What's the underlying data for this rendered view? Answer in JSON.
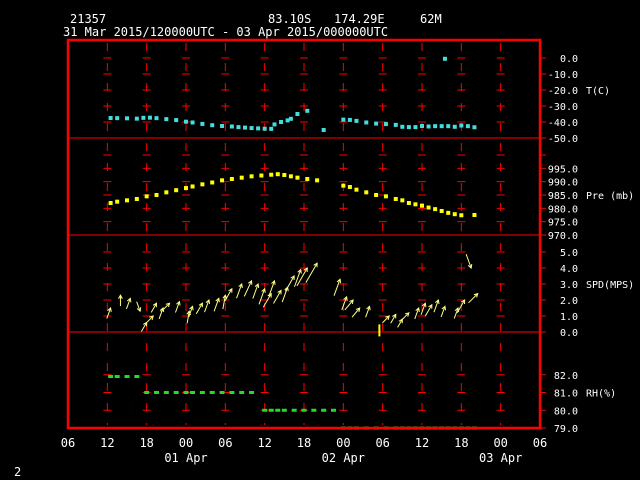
{
  "header": {
    "station": "21357",
    "lat": "83.10S",
    "lon": "174.29E",
    "elev": "62M",
    "period": "31 Mar 2015/120000UTC - 03 Apr 2015/000000UTC"
  },
  "page_number": "2",
  "colors": {
    "frame": "#ff0000",
    "grid": "#ff0000",
    "temp": "#44dddd",
    "pres": "#ffff00",
    "wind": "#ffff88",
    "rh": "#22dd22",
    "text": "#ffffff"
  },
  "chart_data": {
    "type": "scatter",
    "x_axis": {
      "unit": "hours since 31 Mar 2015 00UTC",
      "range": [
        6,
        78
      ],
      "ticks": [
        {
          "h": 6,
          "label": "06"
        },
        {
          "h": 12,
          "label": "12"
        },
        {
          "h": 18,
          "label": "18"
        },
        {
          "h": 24,
          "label": "00"
        },
        {
          "h": 30,
          "label": "06"
        },
        {
          "h": 36,
          "label": "12"
        },
        {
          "h": 42,
          "label": "18"
        },
        {
          "h": 48,
          "label": "00"
        },
        {
          "h": 54,
          "label": "06"
        },
        {
          "h": 60,
          "label": "12"
        },
        {
          "h": 66,
          "label": "18"
        },
        {
          "h": 72,
          "label": "00"
        },
        {
          "h": 78,
          "label": "06"
        }
      ],
      "day_labels": [
        {
          "h": 24,
          "label": "01 Apr"
        },
        {
          "h": 48,
          "label": "02 Apr"
        },
        {
          "h": 72,
          "label": "03 Apr"
        }
      ]
    },
    "panels": [
      {
        "key": "temp",
        "label": "T(C)",
        "range": [
          -50,
          0
        ],
        "ticks": [
          0,
          -10,
          -20,
          -30,
          -40,
          -50
        ],
        "tick_labels": [
          "0.0",
          "-10.0",
          "-20.0",
          "-30.0",
          "-40.0",
          "-50.0"
        ],
        "label_at": -20,
        "points": [
          [
            12.5,
            -37.5
          ],
          [
            13.5,
            -37.6
          ],
          [
            15,
            -37.7
          ],
          [
            16.5,
            -37.9
          ],
          [
            17.5,
            -37.4
          ],
          [
            18.5,
            -37.3
          ],
          [
            19.5,
            -37.6
          ],
          [
            21,
            -38.2
          ],
          [
            22.5,
            -38.8
          ],
          [
            24,
            -39.8
          ],
          [
            25,
            -40.3
          ],
          [
            26.5,
            -41.2
          ],
          [
            28,
            -42
          ],
          [
            29.5,
            -42.5
          ],
          [
            31,
            -42.8
          ],
          [
            32,
            -43.2
          ],
          [
            33,
            -43.5
          ],
          [
            34,
            -43.8
          ],
          [
            35,
            -44
          ],
          [
            36,
            -44.2
          ],
          [
            37,
            -44.3
          ],
          [
            37.5,
            -41.5
          ],
          [
            38.5,
            -40
          ],
          [
            39.5,
            -39
          ],
          [
            40,
            -38
          ],
          [
            41,
            -35
          ],
          [
            42.5,
            -33
          ],
          [
            45,
            -45
          ],
          [
            48,
            -38.5
          ],
          [
            49,
            -38.7
          ],
          [
            50,
            -39.3
          ],
          [
            51.5,
            -40.3
          ],
          [
            53,
            -41
          ],
          [
            54.5,
            -41.3
          ],
          [
            56,
            -41.8
          ],
          [
            57,
            -43
          ],
          [
            58,
            -43.2
          ],
          [
            59,
            -43.2
          ],
          [
            60,
            -42.5
          ],
          [
            61,
            -42.8
          ],
          [
            62,
            -42.6
          ],
          [
            63,
            -42.6
          ],
          [
            64,
            -42.6
          ],
          [
            65,
            -43
          ],
          [
            66,
            -42.2
          ],
          [
            67,
            -42.6
          ],
          [
            68,
            -43.3
          ],
          [
            63.5,
            -0.5
          ]
        ]
      },
      {
        "key": "pres",
        "label": "Pre (mb)",
        "range": [
          970,
          1000
        ],
        "ticks": [
          1000,
          995,
          990,
          985,
          980,
          975,
          970
        ],
        "tick_labels": [
          "",
          "995.0",
          "990.0",
          "985.0",
          "980.0",
          "975.0",
          "970.0"
        ],
        "label_at": 985,
        "points": [
          [
            12.5,
            982
          ],
          [
            13.5,
            982.5
          ],
          [
            15,
            983
          ],
          [
            16.5,
            983.5
          ],
          [
            18,
            984.5
          ],
          [
            19.5,
            985
          ],
          [
            21,
            986
          ],
          [
            22.5,
            986.8
          ],
          [
            24,
            987.6
          ],
          [
            25,
            988.2
          ],
          [
            26.5,
            989
          ],
          [
            28,
            989.7
          ],
          [
            29.5,
            990.5
          ],
          [
            31,
            991
          ],
          [
            32.5,
            991.5
          ],
          [
            34,
            992
          ],
          [
            35.5,
            992.3
          ],
          [
            37,
            992.6
          ],
          [
            38,
            992.8
          ],
          [
            39,
            992.5
          ],
          [
            40,
            992
          ],
          [
            41,
            991.5
          ],
          [
            42.5,
            991
          ],
          [
            44,
            990.5
          ],
          [
            48,
            988.5
          ],
          [
            49,
            988
          ],
          [
            50,
            987
          ],
          [
            51.5,
            986
          ],
          [
            53,
            985
          ],
          [
            54.5,
            984.5
          ],
          [
            56,
            983.5
          ],
          [
            57,
            983
          ],
          [
            58,
            982
          ],
          [
            59,
            981.5
          ],
          [
            60,
            981
          ],
          [
            61,
            980.3
          ],
          [
            62,
            979.7
          ],
          [
            63,
            979
          ],
          [
            64,
            978.3
          ],
          [
            65,
            977.8
          ],
          [
            66,
            977.4
          ],
          [
            68,
            977.5
          ]
        ]
      },
      {
        "key": "wind",
        "label": "SPD(MPS)",
        "range": [
          0,
          5
        ],
        "ticks": [
          5,
          4,
          3,
          2,
          1,
          0
        ],
        "tick_labels": [
          "5.0",
          "4.0",
          "3.0",
          "2.0",
          "1.0",
          "0.0"
        ],
        "label_at": 3,
        "vectors": [
          [
            12.5,
            1.5,
            200,
            1.5
          ],
          [
            14,
            2.3,
            180,
            1.4
          ],
          [
            15.5,
            2.1,
            200,
            1.5
          ],
          [
            17,
            1.3,
            340,
            1.2
          ],
          [
            18,
            0.6,
            210,
            1.3
          ],
          [
            19,
            1.0,
            225,
            1.4
          ],
          [
            19.5,
            1.8,
            210,
            1.3
          ],
          [
            20.5,
            1.5,
            200,
            1.6
          ],
          [
            21.5,
            1.8,
            225,
            1.8
          ],
          [
            23,
            1.9,
            200,
            1.6
          ],
          [
            24.5,
            1.3,
            190,
            1.8
          ],
          [
            25,
            1.6,
            200,
            1.5
          ],
          [
            26.5,
            1.8,
            210,
            1.8
          ],
          [
            27.5,
            2.0,
            200,
            2.0
          ],
          [
            29,
            2.1,
            200,
            2.2
          ],
          [
            30,
            2.3,
            190,
            2.3
          ],
          [
            31,
            2.7,
            210,
            2.4
          ],
          [
            32.5,
            3.0,
            200,
            2.6
          ],
          [
            34,
            3.2,
            205,
            3.2
          ],
          [
            35,
            3.0,
            200,
            2.7
          ],
          [
            36,
            2.7,
            200,
            3.0
          ],
          [
            37,
            2.4,
            210,
            2.8
          ],
          [
            37.5,
            3.2,
            200,
            3.0
          ],
          [
            38.5,
            2.6,
            210,
            2.6
          ],
          [
            39.5,
            2.8,
            200,
            2.8
          ],
          [
            40.5,
            3.5,
            210,
            3.3
          ],
          [
            41.5,
            3.9,
            200,
            3.5
          ],
          [
            42.5,
            4.0,
            210,
            4.2
          ],
          [
            44,
            4.3,
            210,
            4.7
          ],
          [
            47.5,
            3.3,
            200,
            3.3
          ],
          [
            48.5,
            2.2,
            200,
            2.3
          ],
          [
            49.5,
            2.0,
            220,
            2.0
          ],
          [
            50.5,
            1.5,
            220,
            1.7
          ],
          [
            52,
            1.6,
            200,
            1.6
          ],
          [
            55,
            1.0,
            225,
            1.0
          ],
          [
            56,
            1.1,
            210,
            1.2
          ],
          [
            57,
            0.8,
            210,
            1.0
          ],
          [
            58,
            1.2,
            225,
            1.3
          ],
          [
            59.5,
            1.5,
            200,
            1.6
          ],
          [
            60.5,
            1.8,
            200,
            1.8
          ],
          [
            61.5,
            1.7,
            210,
            2.0
          ],
          [
            62.5,
            2.0,
            200,
            2.0
          ],
          [
            63.5,
            1.6,
            200,
            1.5
          ],
          [
            65.5,
            1.5,
            200,
            1.5
          ],
          [
            66.5,
            2.0,
            210,
            2.5
          ],
          [
            67.5,
            4.0,
            340,
            2.5
          ],
          [
            68.5,
            2.4,
            225,
            2.0
          ]
        ],
        "marker": [
          53.5,
          0.1
        ]
      },
      {
        "key": "rh",
        "label": "RH(%)",
        "range": [
          79,
          83
        ],
        "ticks": [
          82,
          81,
          80,
          79
        ],
        "tick_labels": [
          "82.0",
          "81.0",
          "80.0",
          "79.0"
        ],
        "label_at": 81,
        "points": [
          [
            12.5,
            81.9
          ],
          [
            13.5,
            81.9
          ],
          [
            15,
            81.9
          ],
          [
            16.5,
            81.9
          ],
          [
            18,
            81
          ],
          [
            19.5,
            81
          ],
          [
            21,
            81
          ],
          [
            22.5,
            81
          ],
          [
            24,
            81
          ],
          [
            25,
            81
          ],
          [
            26.5,
            81
          ],
          [
            28,
            81
          ],
          [
            29.5,
            81
          ],
          [
            31,
            81
          ],
          [
            32.5,
            81
          ],
          [
            34,
            81
          ],
          [
            36,
            80
          ],
          [
            37,
            80
          ],
          [
            38,
            80
          ],
          [
            39,
            80
          ],
          [
            40.5,
            80
          ],
          [
            42,
            80
          ],
          [
            43.5,
            80
          ],
          [
            45,
            80
          ],
          [
            46.5,
            80
          ],
          [
            48,
            79
          ],
          [
            49,
            79
          ],
          [
            50,
            79
          ],
          [
            51.5,
            79
          ],
          [
            53,
            79
          ],
          [
            54.5,
            79
          ],
          [
            56,
            79
          ],
          [
            57,
            79
          ],
          [
            58,
            79
          ],
          [
            59,
            79
          ],
          [
            60,
            79
          ],
          [
            61,
            79
          ],
          [
            62,
            79
          ],
          [
            63,
            79
          ],
          [
            64,
            79
          ],
          [
            65,
            79
          ],
          [
            66,
            79
          ],
          [
            67,
            79
          ],
          [
            68,
            79
          ]
        ]
      }
    ]
  }
}
